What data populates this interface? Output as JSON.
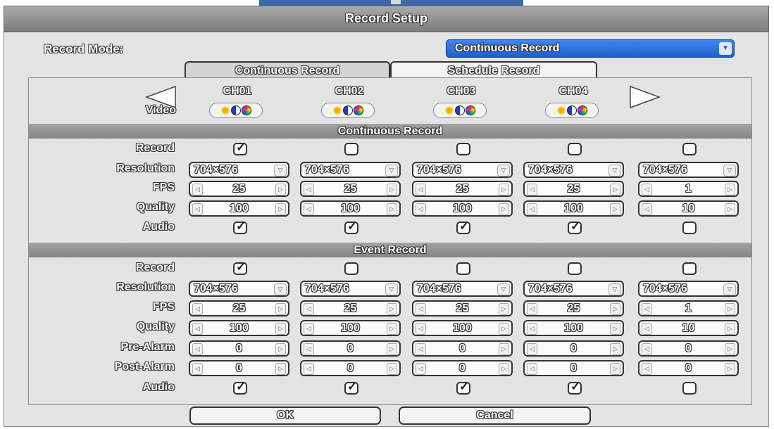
{
  "window": {
    "title": "Record Setup"
  },
  "record_mode": {
    "label": "Record Mode:",
    "value": "Continuous Record"
  },
  "tabs": [
    {
      "label": "Continuous Record",
      "active": true
    },
    {
      "label": "Schedule Record",
      "active": false
    }
  ],
  "video_label": "Video",
  "channels": [
    "CH01",
    "CH02",
    "CH03",
    "CH04"
  ],
  "continuous": {
    "title": "Continuous Record",
    "labels": {
      "record": "Record",
      "resolution": "Resolution",
      "fps": "FPS",
      "quality": "Quality",
      "audio": "Audio"
    },
    "columns": [
      {
        "record": true,
        "resolution": "704×576",
        "fps": "25",
        "quality": "100",
        "audio": true
      },
      {
        "record": false,
        "resolution": "704×576",
        "fps": "25",
        "quality": "100",
        "audio": true
      },
      {
        "record": false,
        "resolution": "704×576",
        "fps": "25",
        "quality": "100",
        "audio": true
      },
      {
        "record": false,
        "resolution": "704×576",
        "fps": "25",
        "quality": "100",
        "audio": true
      },
      {
        "record": false,
        "resolution": "704×576",
        "fps": "1",
        "quality": "10",
        "audio": false
      }
    ]
  },
  "event": {
    "title": "Event Record",
    "labels": {
      "record": "Record",
      "resolution": "Resolution",
      "fps": "FPS",
      "quality": "Quality",
      "pre_alarm": "Pre-Alarm",
      "post_alarm": "Post-Alarm",
      "audio": "Audio"
    },
    "columns": [
      {
        "record": true,
        "resolution": "704×576",
        "fps": "25",
        "quality": "100",
        "pre_alarm": "0",
        "post_alarm": "0",
        "audio": true
      },
      {
        "record": false,
        "resolution": "704×576",
        "fps": "25",
        "quality": "100",
        "pre_alarm": "0",
        "post_alarm": "0",
        "audio": true
      },
      {
        "record": false,
        "resolution": "704×576",
        "fps": "25",
        "quality": "100",
        "pre_alarm": "0",
        "post_alarm": "0",
        "audio": true
      },
      {
        "record": false,
        "resolution": "704×576",
        "fps": "25",
        "quality": "100",
        "pre_alarm": "0",
        "post_alarm": "0",
        "audio": true
      },
      {
        "record": false,
        "resolution": "704×576",
        "fps": "1",
        "quality": "10",
        "pre_alarm": "0",
        "post_alarm": "0",
        "audio": false
      }
    ]
  },
  "buttons": {
    "ok": "OK",
    "cancel": "Cancel"
  },
  "icons": {
    "prev": "triangle-left-icon",
    "next": "triangle-right-icon",
    "dropdown": "chevron-down-icon",
    "spin_left": "small-left-arrow-icon",
    "spin_right": "small-right-arrow-icon",
    "brightness": "sun-icon",
    "contrast": "half-circle-icon",
    "color": "color-wheel-icon",
    "check": "checkmark-icon"
  },
  "colors": {
    "title_bar": "#8f8f8f",
    "dialog_bg": "#e4e4e4",
    "select_bg": "#2f73e0",
    "section_bar": "#959595"
  }
}
